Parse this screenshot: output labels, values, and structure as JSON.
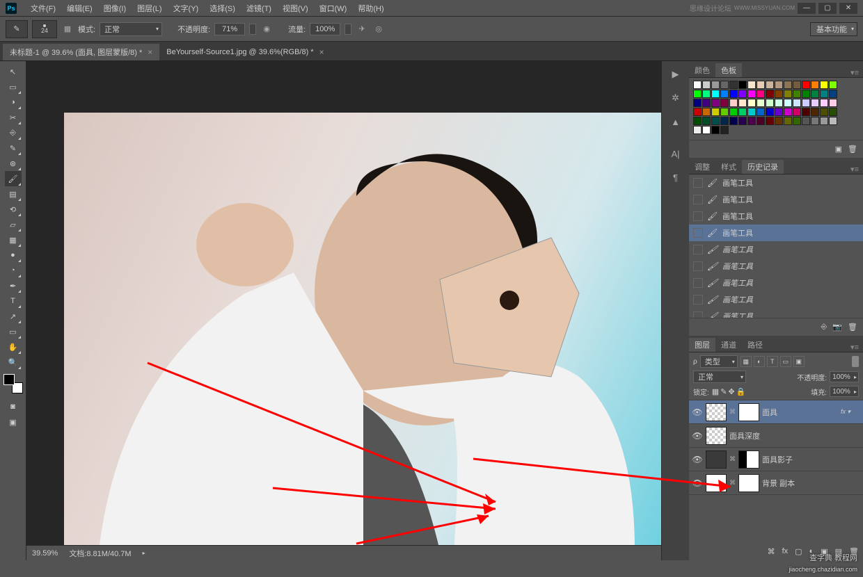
{
  "app": {
    "logo": "Ps"
  },
  "menubar": {
    "items": [
      "文件(F)",
      "编辑(E)",
      "图像(I)",
      "图层(L)",
      "文字(Y)",
      "选择(S)",
      "滤镜(T)",
      "视图(V)",
      "窗口(W)",
      "帮助(H)"
    ],
    "watermark": "思缘设计论坛",
    "watermark_url": "WWW.MISSYUAN.COM"
  },
  "options": {
    "brush_size": "24",
    "mode_label": "模式:",
    "mode_value": "正常",
    "opacity_label": "不透明度:",
    "opacity_value": "71%",
    "flow_label": "流量:",
    "flow_value": "100%",
    "workspace_btn": "基本功能"
  },
  "tabs": [
    {
      "label": "未标题-1 @ 39.6% (面具, 图层蒙版/8) *",
      "active": true
    },
    {
      "label": "BeYourself-Source1.jpg @ 39.6%(RGB/8) *",
      "active": false
    }
  ],
  "tools": [
    "↖",
    "▭",
    "◑",
    "✂",
    "◐",
    "⎚",
    "✎",
    "⌧",
    "▤",
    "⟋",
    "⟋",
    "△",
    "⬒",
    "●",
    "◔",
    "✎",
    "T",
    "↗",
    "▭",
    "✋",
    "🔍"
  ],
  "status": {
    "zoom": "39.59%",
    "doc_label": "文档:",
    "doc_value": "8.81M/40.7M"
  },
  "panel_color": {
    "tab1": "颜色",
    "tab2": "色板"
  },
  "panel_adjust": {
    "tab1": "调整",
    "tab2": "样式",
    "tab3": "历史记录"
  },
  "history": {
    "items": [
      {
        "label": "画笔工具",
        "dim": false
      },
      {
        "label": "画笔工具",
        "dim": false
      },
      {
        "label": "画笔工具",
        "dim": false
      },
      {
        "label": "画笔工具",
        "dim": false,
        "selected": true
      },
      {
        "label": "画笔工具",
        "dim": true
      },
      {
        "label": "画笔工具",
        "dim": true
      },
      {
        "label": "画笔工具",
        "dim": true
      },
      {
        "label": "画笔工具",
        "dim": true
      },
      {
        "label": "画笔工具",
        "dim": true
      }
    ]
  },
  "panel_layers": {
    "tab1": "图层",
    "tab2": "通道",
    "tab3": "路径",
    "filter_label": "类型",
    "blend_value": "正常",
    "opacity_label": "不透明度:",
    "opacity_value": "100%",
    "lock_label": "锁定:",
    "fill_label": "填充:",
    "fill_value": "100%"
  },
  "layers": [
    {
      "name": "面具",
      "selected": true,
      "has_mask": true,
      "fx": true,
      "thumb": "checker"
    },
    {
      "name": "面具深度",
      "thumb": "checker"
    },
    {
      "name": "面具影子",
      "has_mask": true,
      "mask_shape": true,
      "thumb": "dark"
    },
    {
      "name": "背景 副本",
      "has_mask": true,
      "thumb": "solid"
    }
  ],
  "watermark_br": {
    "line1": "查字典 教程网",
    "line2": "jiaocheng.chazidian.com"
  },
  "swatch_colors": [
    "#fff",
    "#ccc",
    "#999",
    "#666",
    "#333",
    "#000",
    "#f5e6cc",
    "#e6ccb3",
    "#ccb399",
    "#b39980",
    "#8c7353",
    "#735c40",
    "#f00",
    "#ff8000",
    "#ff0",
    "#80ff00",
    "#0f0",
    "#00ff80",
    "#0ff",
    "#0080ff",
    "#00f",
    "#8000ff",
    "#f0f",
    "#ff0080",
    "#800000",
    "#804000",
    "#808000",
    "#408000",
    "#008000",
    "#008040",
    "#008080",
    "#004080",
    "#000080",
    "#400080",
    "#800080",
    "#800040",
    "#ffcccc",
    "#ffe6cc",
    "#ffffcc",
    "#e6ffcc",
    "#ccffcc",
    "#ccffe6",
    "#ccffff",
    "#cce6ff",
    "#ccccff",
    "#e6ccff",
    "#ffccff",
    "#ffcce6",
    "#cc0000",
    "#cc6600",
    "#cccc00",
    "#66cc00",
    "#00cc00",
    "#00cc66",
    "#00cccc",
    "#0066cc",
    "#0000cc",
    "#6600cc",
    "#cc00cc",
    "#cc0066",
    "#4d0000",
    "#4d2600",
    "#4d4d00",
    "#264d00",
    "#004d00",
    "#004d26",
    "#004d4d",
    "#00264d",
    "#00004d",
    "#26004d",
    "#4d004d",
    "#4d0026",
    "#660000",
    "#663300",
    "#666600",
    "#336600",
    "#555",
    "#777",
    "#999",
    "#bbb",
    "#eee",
    "#fff",
    "#000",
    "#222"
  ]
}
